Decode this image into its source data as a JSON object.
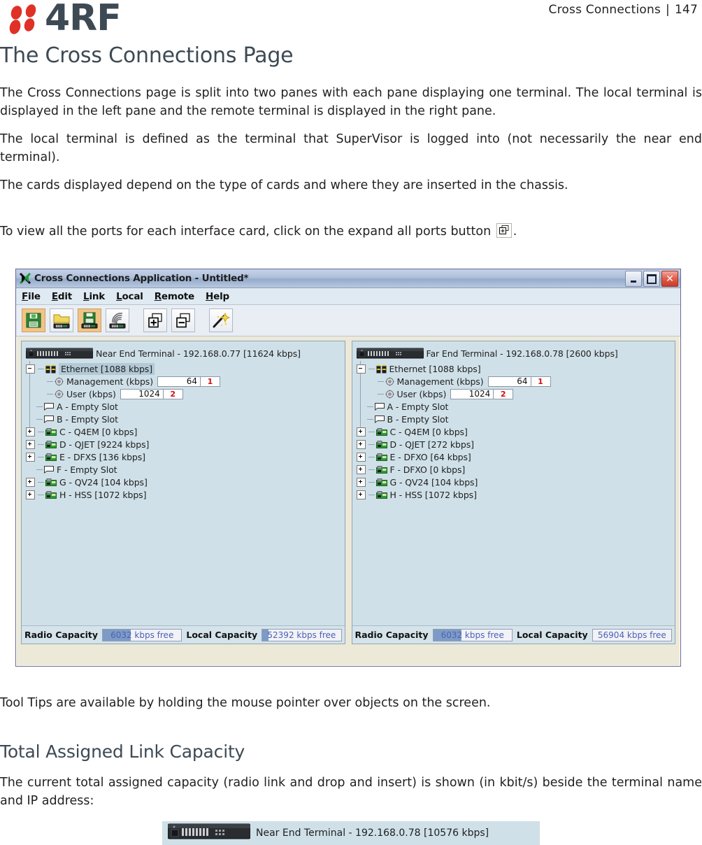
{
  "header": {
    "logo_text": "4RF",
    "chapter": "Cross Connections",
    "separator": "|",
    "page_number": "147"
  },
  "doc": {
    "title": "The Cross Connections Page",
    "para1": "The Cross Connections page is split into two panes with each pane displaying one terminal. The local terminal is displayed in the left pane and the remote terminal is displayed in the right pane.",
    "para2": "The local terminal is defined as the terminal that SuperVisor is logged into (not necessarily the near end terminal).",
    "para3": "The cards displayed depend on the type of cards and where they are inserted in the chassis.",
    "para4_before": "To view all the ports for each interface card, click on the expand all ports button",
    "para4_after": ".",
    "para5": "Tool Tips are available by holding the mouse pointer over objects on the screen.",
    "heading2": "Total Assigned Link Capacity",
    "para6": "The current total assigned capacity (radio link and drop and insert) is shown (in kbit/s) beside the terminal name and IP address:",
    "figure_label": "Near End Terminal - 192.168.0.78 [10576 kbps]"
  },
  "app": {
    "title": "Cross Connections Application - Untitled*",
    "window_buttons": {
      "minimize": "Minimize",
      "maximize": "Maximize",
      "close": "Close"
    },
    "menu": [
      {
        "label": "File",
        "accel": "F"
      },
      {
        "label": "Edit",
        "accel": "E"
      },
      {
        "label": "Link",
        "accel": "L"
      },
      {
        "label": "Local",
        "accel": "L"
      },
      {
        "label": "Remote",
        "accel": "R"
      },
      {
        "label": "Help",
        "accel": "H"
      }
    ],
    "toolbar": [
      {
        "name": "save-icon",
        "title": "Save",
        "active": true
      },
      {
        "name": "open-terminal-icon",
        "title": "Open from terminal",
        "active": false
      },
      {
        "name": "save-terminal-icon",
        "title": "Save to terminal",
        "active": true
      },
      {
        "name": "radio-link-icon",
        "title": "Radio link",
        "active": false
      },
      {
        "name": "expand-all-icon",
        "title": "Expand all ports",
        "active": false
      },
      {
        "name": "collapse-all-icon",
        "title": "Collapse all ports",
        "active": false
      },
      {
        "name": "magic-wand-icon",
        "title": "Auto connect",
        "active": false
      }
    ],
    "panes": [
      {
        "pane_name": "local-pane",
        "terminal": "Near End Terminal - 192.168.0.77 [11624 kbps]",
        "ethernet": {
          "label": "Ethernet [1088 kbps]",
          "selected": true,
          "rows": [
            {
              "label": "Management (kbps)",
              "value": "64",
              "tag": "1"
            },
            {
              "label": "User (kbps)",
              "value": "1024",
              "tag": "2"
            }
          ]
        },
        "slots": [
          {
            "label": "A - Empty Slot",
            "type": "empty"
          },
          {
            "label": "B - Empty Slot",
            "type": "empty"
          },
          {
            "label": "C - Q4EM [0 kbps]",
            "type": "card"
          },
          {
            "label": "D - QJET [9224 kbps]",
            "type": "card"
          },
          {
            "label": "E - DFXS [136 kbps]",
            "type": "card"
          },
          {
            "label": "F - Empty Slot",
            "type": "empty"
          },
          {
            "label": "G - QV24 [104 kbps]",
            "type": "card"
          },
          {
            "label": "H - HSS [1072 kbps]",
            "type": "card"
          }
        ],
        "status": {
          "radio_label": "Radio Capacity",
          "radio_value": "6032 kbps free",
          "radio_fill_pct": 36,
          "local_label": "Local Capacity",
          "local_value": "52392 kbps free",
          "local_fill_pct": 8
        }
      },
      {
        "pane_name": "remote-pane",
        "terminal": "Far End Terminal - 192.168.0.78 [2600 kbps]",
        "ethernet": {
          "label": "Ethernet [1088 kbps]",
          "selected": false,
          "rows": [
            {
              "label": "Management (kbps)",
              "value": "64",
              "tag": "1"
            },
            {
              "label": "User (kbps)",
              "value": "1024",
              "tag": "2"
            }
          ]
        },
        "slots": [
          {
            "label": "A - Empty Slot",
            "type": "empty"
          },
          {
            "label": "B - Empty Slot",
            "type": "empty"
          },
          {
            "label": "C - Q4EM [0 kbps]",
            "type": "card"
          },
          {
            "label": "D - QJET [272 kbps]",
            "type": "card"
          },
          {
            "label": "E - DFXO [64 kbps]",
            "type": "card"
          },
          {
            "label": "F - DFXO [0 kbps]",
            "type": "card"
          },
          {
            "label": "G - QV24 [104 kbps]",
            "type": "card"
          },
          {
            "label": "H - HSS [1072 kbps]",
            "type": "card"
          }
        ],
        "status": {
          "radio_label": "Radio Capacity",
          "radio_value": "6032 kbps free",
          "radio_fill_pct": 36,
          "local_label": "Local Capacity",
          "local_value": "56904 kbps free",
          "local_fill_pct": 0
        }
      }
    ]
  },
  "colors": {
    "brand_red": "#e03127",
    "brand_slate": "#3d4a54",
    "pane_bg": "#cfe0e8",
    "selection": "#b3c9d6",
    "tag_red": "#d01010",
    "cap_fill": "#7e9bc6",
    "cap_text": "#4a63b5"
  }
}
